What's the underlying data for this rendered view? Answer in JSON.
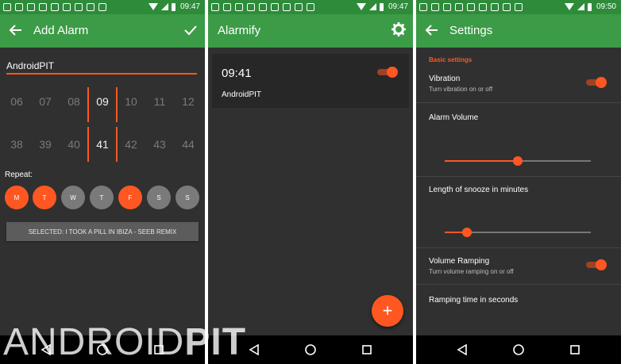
{
  "status": {
    "time_1": "09:47",
    "time_2": "09:47",
    "time_3": "09:50"
  },
  "screen_add_alarm": {
    "title": "Add Alarm",
    "alarm_name_value": "AndroidPIT",
    "hours": [
      "06",
      "07",
      "08",
      "09",
      "10",
      "11",
      "12"
    ],
    "minutes": [
      "38",
      "39",
      "40",
      "41",
      "42",
      "43",
      "44"
    ],
    "selected_hour": "09",
    "selected_minute": "41",
    "repeat_label": "Repeat:",
    "days": [
      {
        "label": "M",
        "active": true
      },
      {
        "label": "T",
        "active": true
      },
      {
        "label": "W",
        "active": false
      },
      {
        "label": "T",
        "active": false
      },
      {
        "label": "F",
        "active": true
      },
      {
        "label": "S",
        "active": false
      },
      {
        "label": "S",
        "active": false
      }
    ],
    "sound_button": "SELECTED: I TOOK A PILL IN IBIZA - SEEB REMIX"
  },
  "screen_alarm_list": {
    "title": "Alarmify",
    "alarms": [
      {
        "time": "09:41",
        "name": "AndroidPIT",
        "enabled": true
      }
    ],
    "fab_label": "+"
  },
  "screen_settings": {
    "title": "Settings",
    "section": "Basic settings",
    "vibration": {
      "title": "Vibration",
      "subtitle": "Turn vibration on or off",
      "enabled": true
    },
    "alarm_volume": {
      "title": "Alarm Volume",
      "level": 0.5
    },
    "snooze": {
      "title": "Length of snooze in minutes",
      "level": 0.15
    },
    "volume_ramping": {
      "title": "Volume Ramping",
      "subtitle": "Turn volume ramping on or off",
      "enabled": true
    },
    "ramping_time": {
      "title": "Ramping time in seconds"
    }
  },
  "watermark": {
    "part1": "ANDROID",
    "part2": "PIT"
  },
  "colors": {
    "primary": "#3c9b46",
    "status": "#2e8b3a",
    "accent": "#ff5722",
    "background": "#303030"
  },
  "icons": [
    "back-arrow-icon",
    "check-icon",
    "settings-gear-icon",
    "nav-back-icon",
    "nav-home-icon",
    "nav-recents-icon",
    "wifi-icon",
    "signal-icon",
    "battery-icon"
  ]
}
